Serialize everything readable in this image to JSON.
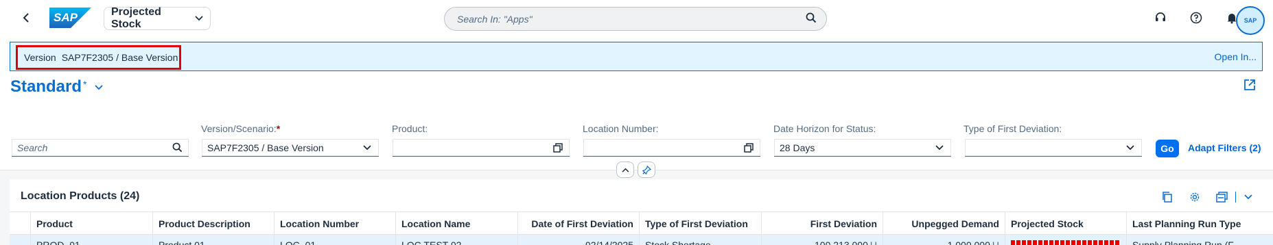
{
  "shell": {
    "app_title": "Projected Stock",
    "search_placeholder": "Search In: \"Apps\"",
    "logo_text": "SAP",
    "avatar_text": "SAP"
  },
  "banner": {
    "version_label": "Version",
    "version_value": "SAP7F2305 / Base Version",
    "open_in": "Open In..."
  },
  "variant": {
    "title": "Standard",
    "modified_mark": "*"
  },
  "filters": {
    "search_placeholder": "Search",
    "version_label": "Version/Scenario:",
    "version_required": "*",
    "version_value": "SAP7F2305 / Base Version",
    "product_label": "Product:",
    "product_value": "",
    "location_label": "Location Number:",
    "location_value": "",
    "horizon_label": "Date Horizon for Status:",
    "horizon_value": "28 Days",
    "deviation_label": "Type of First Deviation:",
    "deviation_value": "",
    "go": "Go",
    "adapt": "Adapt Filters (2)"
  },
  "table": {
    "title": "Location Products (24)",
    "columns": [
      "Product",
      "Product Description",
      "Location Number",
      "Location Name",
      "Date of First Deviation",
      "Type of First Deviation",
      "First Deviation",
      "Unpegged Demand",
      "Projected Stock",
      "Last Planning Run Type"
    ],
    "rows": [
      {
        "product": "PROD_01",
        "description": "Product 01",
        "location_number": "LOC_01",
        "location_name": "LOC TEST 02",
        "date_first_deviation": "02/14/2025",
        "type_first_deviation": "Stock Shortage",
        "first_deviation": "100,213.000",
        "first_deviation_unit": "U",
        "unpegged_demand": "1,000.000",
        "unpegged_demand_unit": "U",
        "last_run_type": "Supply Planning Run (F"
      }
    ]
  },
  "colors": {
    "brand": "#0a6ed1",
    "highlight": "#e00000",
    "banner_bg": "#e1f4ff"
  }
}
